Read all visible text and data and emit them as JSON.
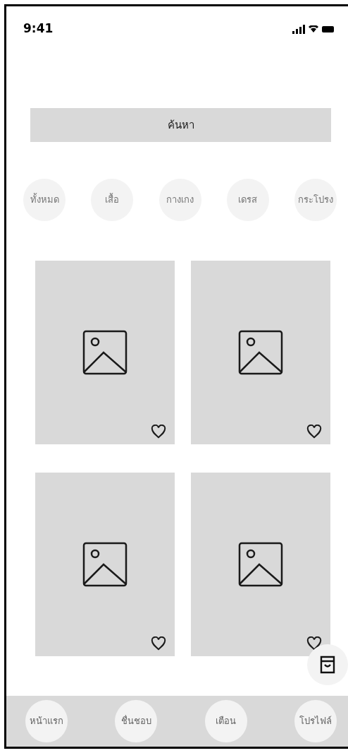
{
  "status_bar": {
    "time": "9:41"
  },
  "search": {
    "placeholder": "ค้นหา"
  },
  "categories": [
    {
      "label": "ทั้งหมด"
    },
    {
      "label": "เสื้อ"
    },
    {
      "label": "กางเกง"
    },
    {
      "label": "เดรส"
    },
    {
      "label": "กระโปรง"
    }
  ],
  "products": [
    {
      "liked": false
    },
    {
      "liked": false
    },
    {
      "liked": false
    },
    {
      "liked": false
    }
  ],
  "bottom_nav": [
    {
      "label": "หน้าแรก"
    },
    {
      "label": "ชื่นชอบ"
    },
    {
      "label": "เตือน"
    },
    {
      "label": "โปรไฟล์"
    }
  ]
}
